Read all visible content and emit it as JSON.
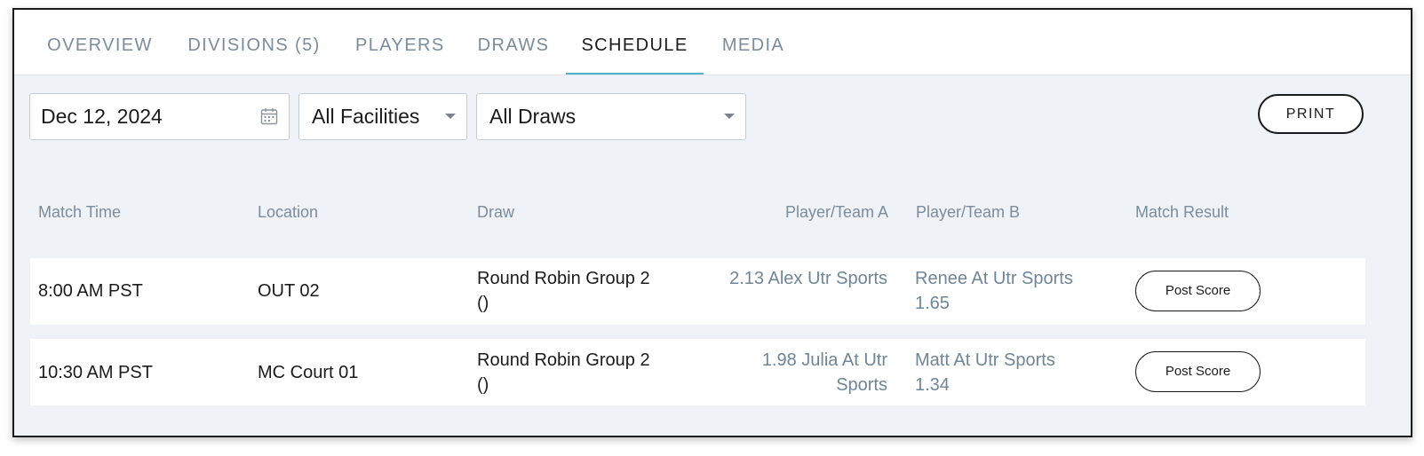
{
  "tabs": [
    {
      "label": "OVERVIEW"
    },
    {
      "label": "DIVISIONS (5)"
    },
    {
      "label": "PLAYERS"
    },
    {
      "label": "DRAWS"
    },
    {
      "label": "SCHEDULE",
      "active": true
    },
    {
      "label": "MEDIA"
    }
  ],
  "filters": {
    "date": "Dec 12, 2024",
    "facility": "All Facilities",
    "draw": "All Draws",
    "print_label": "PRINT"
  },
  "table": {
    "headers": [
      "Match Time",
      "Location",
      "Draw",
      "Player/Team A",
      "Player/Team B",
      "Match Result"
    ],
    "rows": [
      {
        "time": "8:00 AM PST",
        "location": "OUT 02",
        "draw_line1": "Round Robin Group 2",
        "draw_line2": "()",
        "player_a": "2.13 Alex Utr Sports",
        "player_b_line1": "Renee At Utr Sports",
        "player_b_line2": "1.65",
        "result_label": "Post Score"
      },
      {
        "time": "10:30 AM PST",
        "location": "MC Court 01",
        "draw_line1": "Round Robin Group 2",
        "draw_line2": "()",
        "player_a_line1": "1.98 Julia At Utr",
        "player_a_line2": "Sports",
        "player_b_line1": "Matt At Utr Sports",
        "player_b_line2": "1.34",
        "result_label": "Post Score"
      }
    ]
  },
  "colors": {
    "accent": "#4fb2cf",
    "muted_text": "#7b8c9c",
    "player_link": "#6f8598",
    "background": "#eff2f7"
  },
  "icons": {
    "date": "calendar-icon",
    "dropdown": "chevron-down-icon"
  }
}
